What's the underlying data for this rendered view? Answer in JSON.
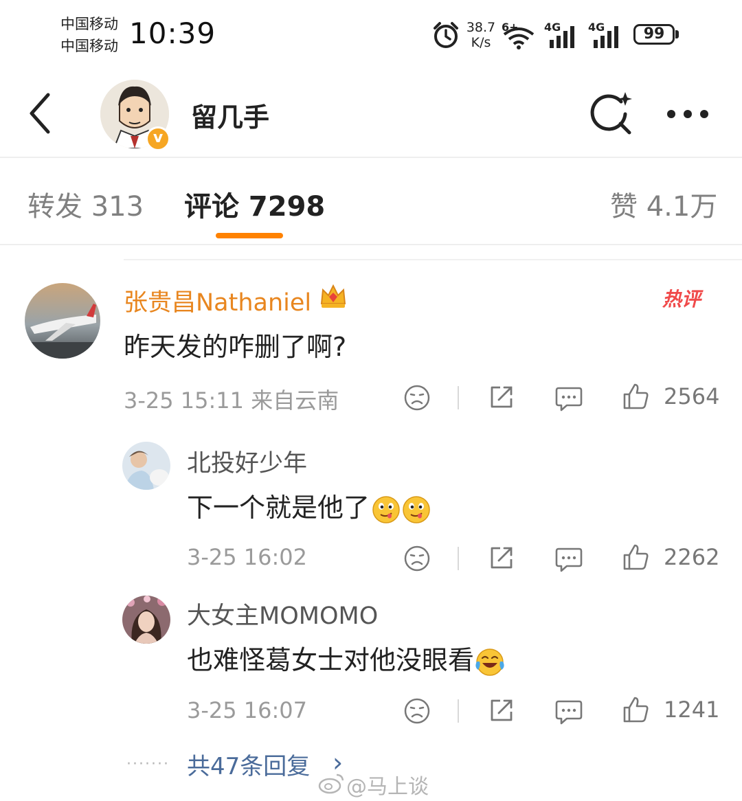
{
  "status_bar": {
    "carrier_1": "中国移动",
    "carrier_2": "中国移动",
    "time": "10:39",
    "net_speed_value": "38.7",
    "net_speed_unit": "K/s",
    "wifi_tag": "6+",
    "signal_1_tag": "4G",
    "signal_2_tag": "4G",
    "battery": "99"
  },
  "header": {
    "title": "留几手",
    "verified_badge": "v"
  },
  "tabs": [
    {
      "label": "转发 313"
    },
    {
      "label": "评论 7298"
    },
    {
      "label": "赞 4.1万"
    }
  ],
  "comment": {
    "username": "张贵昌Nathaniel",
    "hot_badge": "热评",
    "text": "昨天发的咋删了啊?",
    "meta": "3-25 15:11 来自云南",
    "likes": "2564"
  },
  "replies": [
    {
      "username": "北投好少年",
      "text": "下一个就是他了",
      "meta": "3-25 16:02",
      "likes": "2262"
    },
    {
      "username": "大女主MOMOMO",
      "text": "也难怪葛女士对他没眼看",
      "meta": "3-25 16:07",
      "likes": "1241"
    }
  ],
  "more_replies": {
    "dots": "·······",
    "label": "共47条回复",
    "chevron": "›"
  },
  "watermark": "@马上谈",
  "colors": {
    "accent": "#ff8200",
    "username_highlight": "#e8861f",
    "hot_badge": "#f04a4a",
    "link": "#4a6b9a"
  }
}
